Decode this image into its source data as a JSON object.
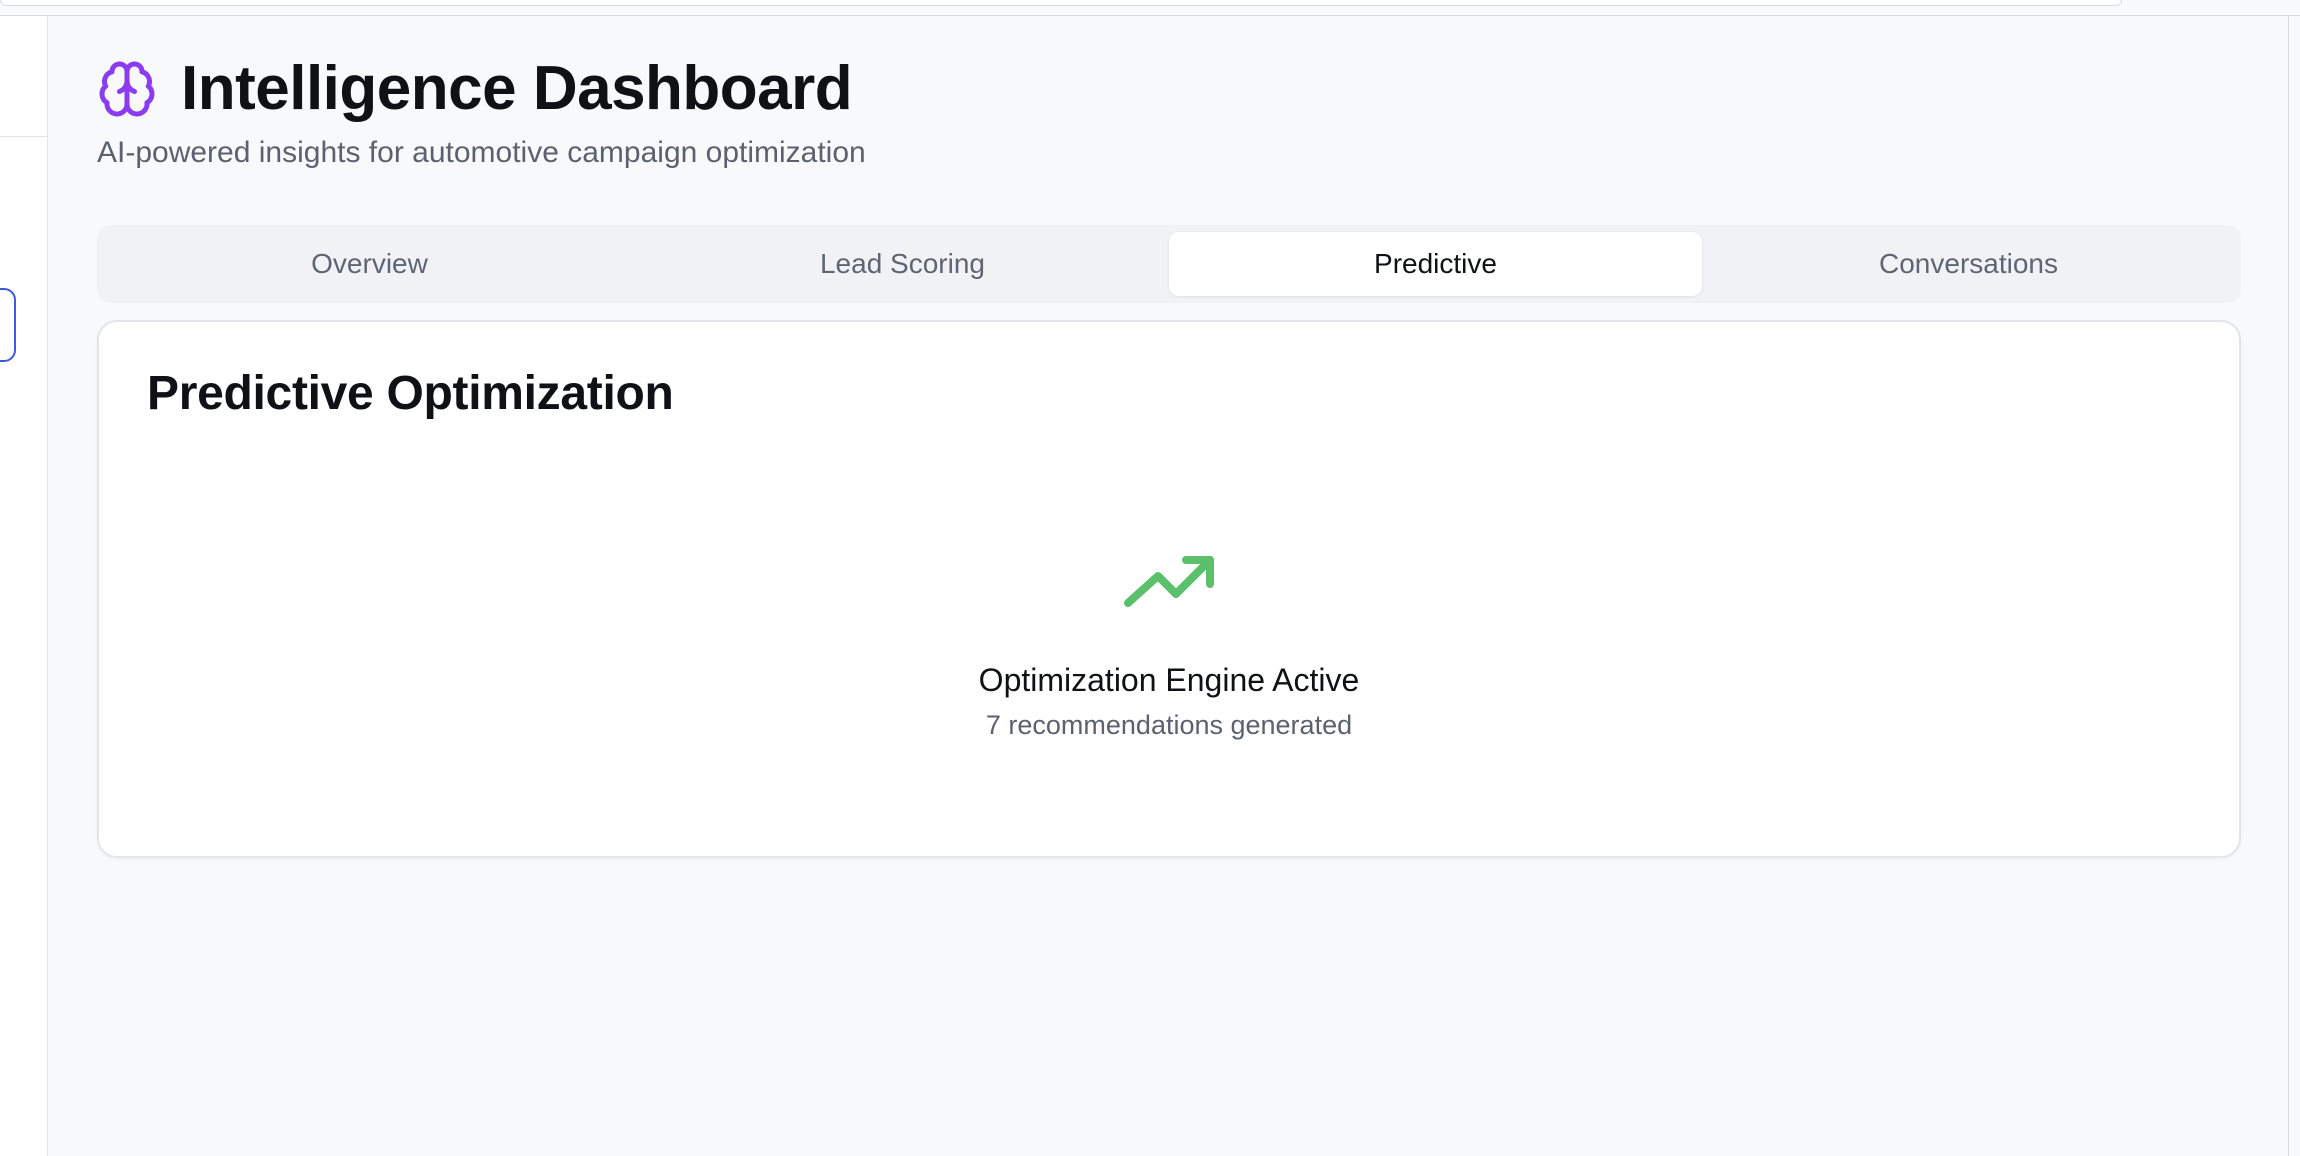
{
  "header": {
    "icon": "brain-icon",
    "title": "Intelligence Dashboard",
    "subtitle": "AI-powered insights for automotive campaign optimization"
  },
  "tabs": [
    {
      "label": "Overview",
      "active": false
    },
    {
      "label": "Lead Scoring",
      "active": false
    },
    {
      "label": "Predictive",
      "active": true
    },
    {
      "label": "Conversations",
      "active": false
    }
  ],
  "card": {
    "title": "Predictive Optimization",
    "status_icon": "trending-up-icon",
    "status": "Optimization Engine Active",
    "recommendations": "7 recommendations generated"
  },
  "colors": {
    "brand_purple": "#8b3cf0",
    "success_green": "#5cbf6b",
    "page_background": "#f8f9fb"
  }
}
